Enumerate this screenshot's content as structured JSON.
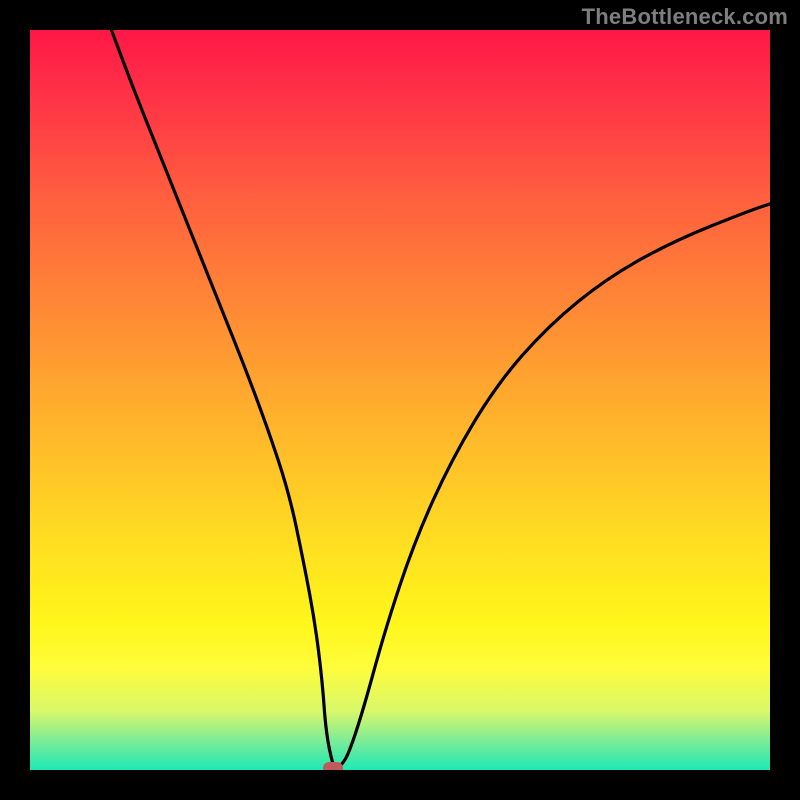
{
  "watermark": "TheBottleneck.com",
  "chart_data": {
    "type": "line",
    "title": "",
    "xlabel": "",
    "ylabel": "",
    "x_range": [
      0,
      100
    ],
    "y_range": [
      0,
      100
    ],
    "series": [
      {
        "name": "curve",
        "x": [
          11,
          14,
          17,
          20,
          23,
          26,
          29,
          32,
          35,
          37,
          38.5,
          39.5,
          40,
          41,
          41.5,
          42,
          43,
          45,
          48,
          52,
          57,
          63,
          70,
          78,
          87,
          97,
          100
        ],
        "y": [
          100,
          92,
          84.5,
          77,
          69.5,
          62,
          54.5,
          46.5,
          37.5,
          28,
          20,
          12,
          5,
          0.3,
          0.3,
          0.6,
          2,
          8,
          19,
          31,
          42,
          52,
          60,
          66.5,
          71.5,
          75.5,
          76.5
        ]
      }
    ],
    "marker": {
      "x": 41,
      "y": 0.3
    },
    "gradient_stops": [
      {
        "pct": 0,
        "color": "#ff1846"
      },
      {
        "pct": 22,
        "color": "#ff5d3f"
      },
      {
        "pct": 54,
        "color": "#ffb62b"
      },
      {
        "pct": 80,
        "color": "#fff61a"
      },
      {
        "pct": 100,
        "color": "#1de9b6"
      }
    ]
  }
}
